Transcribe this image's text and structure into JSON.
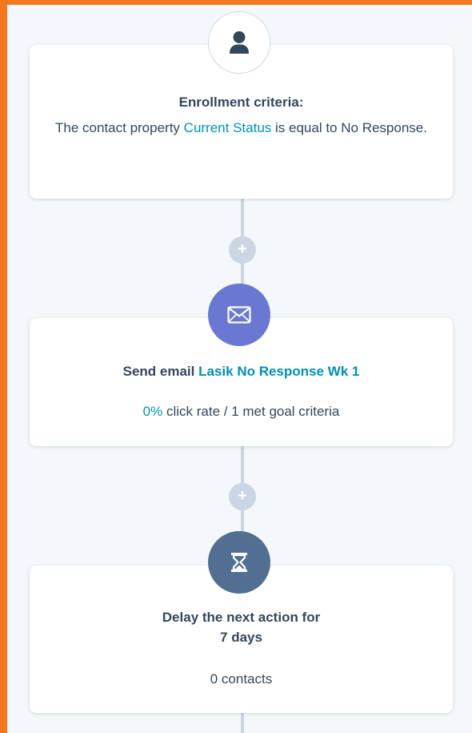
{
  "trigger": {
    "icon": "contact-person-icon",
    "title": "Enrollment criteria:",
    "text_prefix": "The contact property",
    "property_link": "Current Status",
    "text_middle": "is equal to",
    "value": "No Response."
  },
  "step_email": {
    "icon": "envelope-icon",
    "action": "Send email",
    "email_link": "Lasik No Response Wk 1",
    "rate_value": "0%",
    "rate_text": "click rate / 1 met goal criteria"
  },
  "step_delay": {
    "icon": "hourglass-icon",
    "line1": "Delay the next action for",
    "line2": "7 days",
    "contacts": "0 contacts"
  },
  "add_action": {
    "symbol": "+"
  },
  "colors": {
    "frame": "#f3781f",
    "link": "#0091ae",
    "email_circle": "#6a78d1",
    "delay_circle": "#516f90",
    "rail": "#cbd6e2"
  }
}
